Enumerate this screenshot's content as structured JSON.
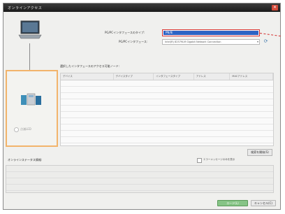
{
  "window": {
    "title": "オンラインアクセス"
  },
  "form": {
    "pg_pc_type_label": "PG/PCインタフェースのタイプ:",
    "pg_pc_type_value": "PN/IE",
    "pg_pc_iface_label": "PG/PCインタフェース:",
    "pg_pc_iface_value": "Intel(R) 82579LM Gigabit Network Connection"
  },
  "target_devices": {
    "section_title": "選択したインタフェースのアクセス可能ノード:",
    "columns": [
      "デバイス",
      "デバイスタイプ",
      "インタフェースタイプ",
      "アドレス",
      "MACアドレス"
    ],
    "rows": []
  },
  "device_panel": {
    "radio_label": "点滅LED"
  },
  "buttons": {
    "start_search": "検索を開始(S)",
    "load": "ロード(L)",
    "cancel": "キャンセル(C)"
  },
  "online_status": {
    "label": "オンラインステータス情報:",
    "only_errors_label": "エラーメッセージのみを表示"
  }
}
